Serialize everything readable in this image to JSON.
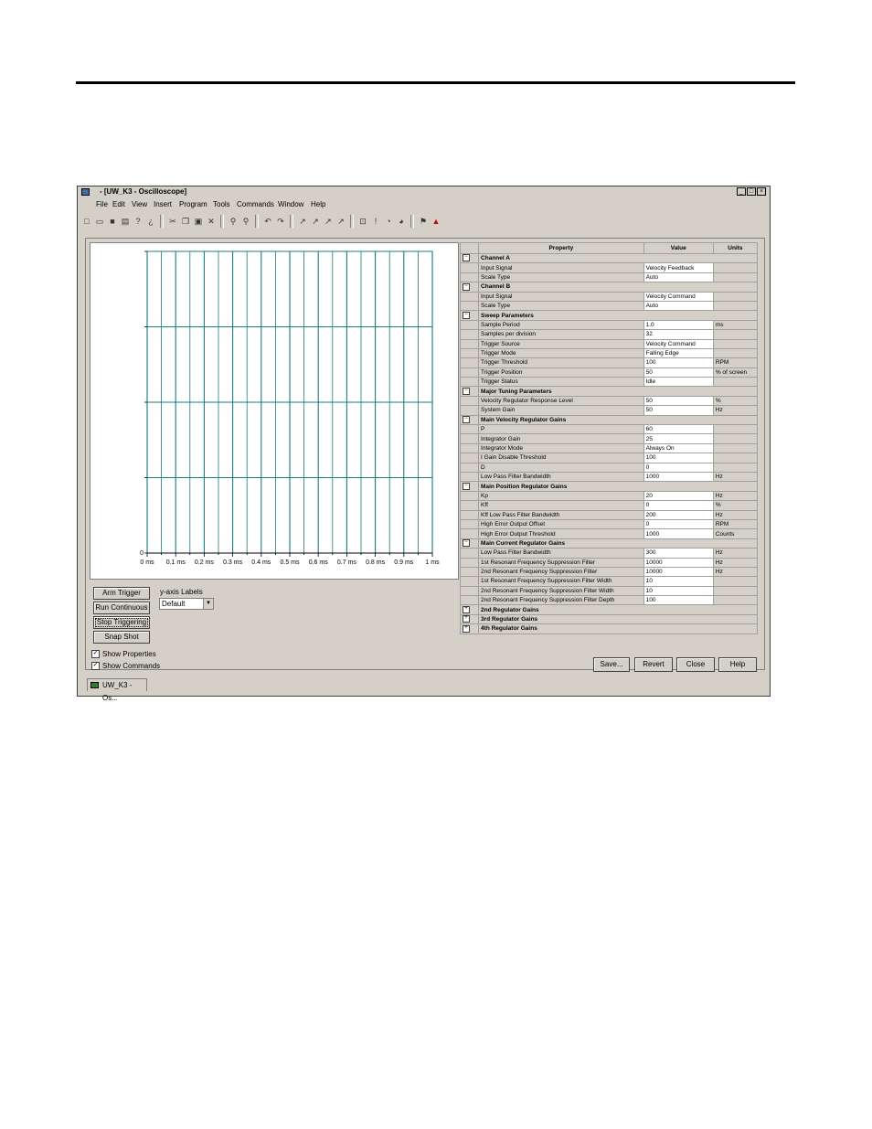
{
  "window": {
    "title": "- [UW_K3 - Oscilloscope]",
    "controls": [
      "_",
      "□",
      "×"
    ]
  },
  "menu": [
    "File",
    "Edit",
    "View",
    "Insert",
    "Program",
    "Tools",
    "Commands",
    "Window",
    "Help"
  ],
  "toolbar": {
    "icons": [
      "new-icon",
      "open-icon",
      "save-icon",
      "print-icon",
      "help-icon",
      "context-help-icon",
      "cut-icon",
      "copy-icon",
      "paste-icon",
      "delete-icon",
      "find-icon",
      "find-next-icon",
      "undo-icon",
      "redo-icon",
      "verify-icon",
      "compile-icon",
      "build-icon",
      "download-icon",
      "connect-icon",
      "stop-icon",
      "run-icon",
      "monitor-icon",
      "watch-icon",
      "alarm-icon"
    ]
  },
  "chart_data": {
    "type": "line",
    "x_tick_labels": [
      "0 ms",
      "0.1 ms",
      "0.2 ms",
      "0.3 ms",
      "0.4 ms",
      "0.5 ms",
      "0.6 ms",
      "0.7 ms",
      "0.8 ms",
      "0.9 ms",
      "1 ms"
    ],
    "y_tick_labels": [
      "0"
    ],
    "xlim": [
      0,
      1
    ],
    "grid": true,
    "series": []
  },
  "scope_controls": {
    "arm_trigger": "Arm Trigger",
    "run_continuous": "Run Continuous",
    "stop_triggering": "Stop Triggering",
    "snap_shot": "Snap Shot",
    "y_axis_labels_title": "y-axis Labels",
    "y_axis_labels_value": "Default",
    "show_properties": "Show Properties",
    "show_commands": "Show Commands"
  },
  "properties": {
    "headers": [
      "Property",
      "Value",
      "Units"
    ],
    "rows": [
      {
        "type": "category",
        "expander": "−",
        "name": "Channel A"
      },
      {
        "type": "item",
        "name": "Input Signal",
        "value": "Velocity Feedback",
        "units": ""
      },
      {
        "type": "item",
        "name": "Scale Type",
        "value": "Auto",
        "units": ""
      },
      {
        "type": "category",
        "expander": "−",
        "name": "Channel B"
      },
      {
        "type": "item",
        "name": "Input Signal",
        "value": "Velocity Command",
        "units": ""
      },
      {
        "type": "item",
        "name": "Scale Type",
        "value": "Auto",
        "units": ""
      },
      {
        "type": "category",
        "expander": "−",
        "name": "Sweep Parameters"
      },
      {
        "type": "item",
        "name": "Sample Period",
        "value": "1.0",
        "units": "ms"
      },
      {
        "type": "item",
        "name": "Samples per division",
        "value": "32",
        "units": ""
      },
      {
        "type": "item",
        "name": "Trigger Source",
        "value": "Velocity Command",
        "units": ""
      },
      {
        "type": "item",
        "name": "Trigger Mode",
        "value": "Falling Edge",
        "units": ""
      },
      {
        "type": "item",
        "name": "Trigger Threshold",
        "value": "100",
        "units": "RPM"
      },
      {
        "type": "item",
        "name": "Trigger Position",
        "value": "50",
        "units": "% of screen"
      },
      {
        "type": "item",
        "name": "Trigger Status",
        "value": "Idle",
        "units": ""
      },
      {
        "type": "category",
        "expander": "−",
        "name": "Major Tuning Parameters"
      },
      {
        "type": "item",
        "name": "Velocity Regulator Response Level",
        "value": "50",
        "units": "%"
      },
      {
        "type": "item",
        "name": "System Gain",
        "value": "50",
        "units": "Hz"
      },
      {
        "type": "category",
        "expander": "−",
        "name": "Main Velocity Regulator Gains"
      },
      {
        "type": "item",
        "name": "P",
        "value": "60",
        "units": ""
      },
      {
        "type": "item",
        "name": "Integrator Gain",
        "value": "25",
        "units": ""
      },
      {
        "type": "item",
        "name": "Integrator Mode",
        "value": "Always On",
        "units": ""
      },
      {
        "type": "item",
        "name": "I Gain Disable Threshold",
        "value": "100",
        "units": ""
      },
      {
        "type": "item",
        "name": "D",
        "value": "0",
        "units": ""
      },
      {
        "type": "item",
        "name": "Low Pass Filter Bandwidth",
        "value": "1000",
        "units": "Hz"
      },
      {
        "type": "category",
        "expander": "−",
        "name": "Main Position Regulator Gains"
      },
      {
        "type": "item",
        "name": "Kp",
        "value": "20",
        "units": "Hz"
      },
      {
        "type": "item",
        "name": "Kff",
        "value": "0",
        "units": "%"
      },
      {
        "type": "item",
        "name": "Kff Low Pass Filter Bandwidth",
        "value": "200",
        "units": "Hz"
      },
      {
        "type": "item",
        "name": "High Error Output Offset",
        "value": "0",
        "units": "RPM"
      },
      {
        "type": "item",
        "name": "High Error Output Threshold",
        "value": "1000",
        "units": "Counts"
      },
      {
        "type": "category",
        "expander": "−",
        "name": "Main Current Regulator Gains"
      },
      {
        "type": "item",
        "name": "Low Pass Filter Bandwidth",
        "value": "300",
        "units": "Hz"
      },
      {
        "type": "item",
        "name": "1st Resonant Frequency Suppression Filter",
        "value": "10000",
        "units": "Hz"
      },
      {
        "type": "item",
        "name": "2nd Resonant Frequency Suppression Filter",
        "value": "10000",
        "units": "Hz"
      },
      {
        "type": "item",
        "name": "1st Resonant Frequency Suppression Filter Width",
        "value": "10",
        "units": ""
      },
      {
        "type": "item",
        "name": "2nd Resonant Frequency Suppression Filter Width",
        "value": "10",
        "units": ""
      },
      {
        "type": "item",
        "name": "2nd Resonant Frequency Suppression Filter Depth",
        "value": "100",
        "units": ""
      },
      {
        "type": "category",
        "expander": "+",
        "name": "2nd Regulator Gains"
      },
      {
        "type": "category",
        "expander": "+",
        "name": "3rd Regulator Gains"
      },
      {
        "type": "category",
        "expander": "+",
        "name": "4th Regulator Gains"
      }
    ]
  },
  "buttons": {
    "save": "Save...",
    "revert": "Revert",
    "close": "Close",
    "help": "Help"
  },
  "tab": {
    "label": "UW_K3 - Os..."
  }
}
